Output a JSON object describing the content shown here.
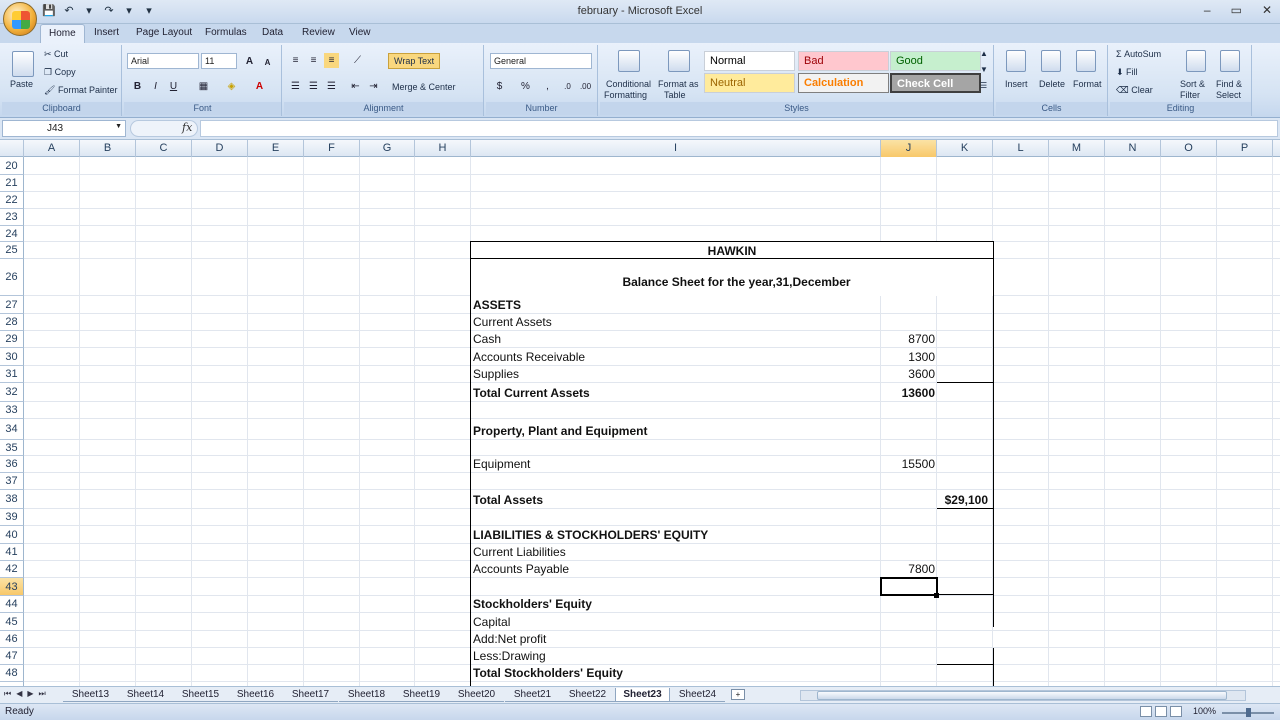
{
  "window": {
    "title": "february - Microsoft Excel",
    "controls": [
      "–",
      "▭",
      "✕"
    ]
  },
  "qat": [
    "💾",
    "↶",
    "▾",
    "↷",
    "▾",
    "▾"
  ],
  "ribbon_tabs": [
    "Home",
    "Insert",
    "Page Layout",
    "Formulas",
    "Data",
    "Review",
    "View"
  ],
  "ribbon": {
    "clipboard": {
      "paste": "Paste",
      "cut": "Cut",
      "copy": "Copy",
      "format_painter": "Format Painter",
      "label": "Clipboard"
    },
    "font": {
      "name": "Arial",
      "size": "11",
      "grow": "A",
      "shrink": "A",
      "bold": "B",
      "italic": "I",
      "underline": "U",
      "label": "Font"
    },
    "alignment": {
      "wrap_text": "Wrap Text",
      "merge_center": "Merge & Center",
      "label": "Alignment"
    },
    "number": {
      "format": "General",
      "currency": "$",
      "percent": "%",
      "comma": ",",
      "label": "Number"
    },
    "styles": {
      "conditional": [
        "Conditional",
        "Formatting"
      ],
      "format_table": [
        "Format as",
        "Table"
      ],
      "cells": [
        {
          "label": "Normal",
          "bg": "#ffffff",
          "fg": "#000000"
        },
        {
          "label": "Bad",
          "bg": "#ffc7ce",
          "fg": "#9c0006"
        },
        {
          "label": "Good",
          "bg": "#c6efce",
          "fg": "#006100"
        },
        {
          "label": "Neutral",
          "bg": "#ffeb9c",
          "fg": "#9c6500"
        },
        {
          "label": "Calculation",
          "bg": "#f2f2f2",
          "fg": "#fa7d00"
        },
        {
          "label": "Check Cell",
          "bg": "#a5a5a5",
          "fg": "#ffffff"
        }
      ],
      "label": "Styles"
    },
    "cells": {
      "insert": "Insert",
      "delete": "Delete",
      "format": "Format",
      "label": "Cells"
    },
    "editing": {
      "autosum": "AutoSum",
      "fill": "Fill",
      "clear": "Clear",
      "sort": [
        "Sort &",
        "Filter"
      ],
      "find": [
        "Find &",
        "Select"
      ],
      "label": "Editing"
    }
  },
  "formula_bar": {
    "name_box": "J43",
    "fx": "fx",
    "content": ""
  },
  "columns": [
    "A",
    "B",
    "C",
    "D",
    "E",
    "F",
    "G",
    "H",
    "I",
    "J",
    "K",
    "L",
    "M",
    "N",
    "O",
    "P"
  ],
  "selected_column": "J",
  "rows": [
    "20",
    "21",
    "22",
    "23",
    "24",
    "25",
    "26",
    "27",
    "28",
    "29",
    "30",
    "31",
    "32",
    "33",
    "34",
    "35",
    "36",
    "37",
    "38",
    "39",
    "40",
    "41",
    "42",
    "43",
    "44",
    "45",
    "46",
    "47",
    "48",
    "49"
  ],
  "selected_row": "43",
  "balance_sheet": {
    "company": "HAWKIN",
    "title": "Balance Sheet for the year,31,December",
    "lines": [
      {
        "row": "27",
        "label": "ASSETS",
        "bold": true,
        "j": "",
        "k": ""
      },
      {
        "row": "28",
        "label": "Current Assets",
        "bold": false,
        "j": "",
        "k": ""
      },
      {
        "row": "29",
        "label": "Cash",
        "bold": false,
        "j": "8700",
        "k": ""
      },
      {
        "row": "30",
        "label": "Accounts Receivable",
        "bold": false,
        "j": "1300",
        "k": ""
      },
      {
        "row": "31",
        "label": "Supplies",
        "bold": false,
        "j": "3600",
        "k": ""
      },
      {
        "row": "32",
        "label": "Total Current Assets",
        "bold": true,
        "j": "13600",
        "k": ""
      },
      {
        "row": "34",
        "label": "Property, Plant and Equipment",
        "bold": true,
        "j": "",
        "k": ""
      },
      {
        "row": "36",
        "label": "Equipment",
        "bold": false,
        "j": "15500",
        "k": ""
      },
      {
        "row": "38",
        "label": "Total Assets",
        "bold": true,
        "j": "",
        "k": "$29,100"
      },
      {
        "row": "40",
        "label": "LIABILITIES & STOCKHOLDERS' EQUITY",
        "bold": true,
        "j": "",
        "k": ""
      },
      {
        "row": "41",
        "label": "Current Liabilities",
        "bold": false,
        "j": "",
        "k": ""
      },
      {
        "row": "42",
        "label": "Accounts Payable",
        "bold": false,
        "j": "7800",
        "k": ""
      },
      {
        "row": "44",
        "label": "Stockholders' Equity",
        "bold": true,
        "j": "",
        "k": ""
      },
      {
        "row": "45",
        "label": "Capital",
        "bold": false,
        "j": "",
        "k": ""
      },
      {
        "row": "46",
        "label": "Add:Net profit",
        "bold": false,
        "j": "",
        "k": ""
      },
      {
        "row": "47",
        "label": "Less:Drawing",
        "bold": false,
        "j": "",
        "k": ""
      },
      {
        "row": "48",
        "label": "Total Stockholders' Equity",
        "bold": true,
        "j": "",
        "k": ""
      }
    ]
  },
  "sheet_tabs": [
    "Sheet13",
    "Sheet14",
    "Sheet15",
    "Sheet16",
    "Sheet17",
    "Sheet18",
    "Sheet19",
    "Sheet20",
    "Sheet21",
    "Sheet22",
    "Sheet23",
    "Sheet24"
  ],
  "active_sheet": "Sheet23",
  "status": {
    "text": "Ready",
    "zoom": "100%"
  }
}
